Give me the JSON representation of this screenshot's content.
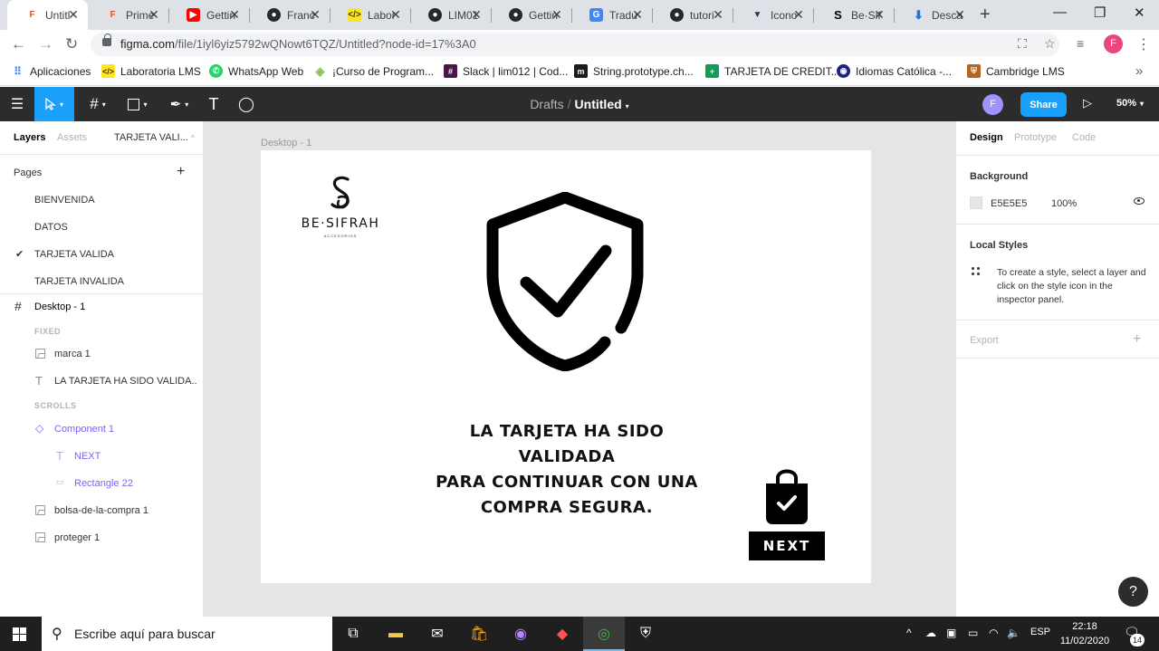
{
  "browser": {
    "tabs": [
      {
        "title": "Untitl",
        "icon": "figma-icon",
        "color": "#f24e1e"
      },
      {
        "title": "Prime",
        "icon": "figma-icon",
        "color": "#f24e1e"
      },
      {
        "title": "Gettin",
        "icon": "youtube-icon",
        "color": "#ff0000"
      },
      {
        "title": "Franc",
        "icon": "github-icon",
        "color": "#24292e"
      },
      {
        "title": "Labor",
        "icon": "laboratoria-icon",
        "color": "#ffe521"
      },
      {
        "title": "LIM01",
        "icon": "github-icon",
        "color": "#24292e"
      },
      {
        "title": "Gettin",
        "icon": "github-icon",
        "color": "#24292e"
      },
      {
        "title": "Tradu",
        "icon": "translate-icon",
        "color": "#4285f4"
      },
      {
        "title": "tutori",
        "icon": "github-icon",
        "color": "#24292e"
      },
      {
        "title": "Icono",
        "icon": "flaticon-icon",
        "color": "#1d3557"
      },
      {
        "title": "Be·Sif",
        "icon": "besifrah-icon",
        "color": "#000000"
      },
      {
        "title": "Desca",
        "icon": "download-icon",
        "color": "#1a73e8"
      }
    ],
    "url_host": "figma.com",
    "url_path": "/file/1iyl6yiz5792wQNowt6TQZ/Untitled?node-id=17%3A0",
    "profile_initial": "F",
    "bookmarks": [
      {
        "label": "Aplicaciones",
        "icon": "apps-grid-icon",
        "color": "#4285f4"
      },
      {
        "label": "Laboratoria LMS",
        "icon": "laboratoria-icon",
        "color": "#ffe521"
      },
      {
        "label": "WhatsApp Web",
        "icon": "whatsapp-icon",
        "color": "#25d366"
      },
      {
        "label": "¡Curso de Program...",
        "icon": "diamond-icon",
        "color": "#8bc34a"
      },
      {
        "label": "Slack | lim012 | Cod...",
        "icon": "slack-icon",
        "color": "#4a154b"
      },
      {
        "label": "String.prototype.ch...",
        "icon": "mdn-icon",
        "color": "#1b1b1b"
      },
      {
        "label": "TARJETA DE CREDIT...",
        "icon": "sheets-icon",
        "color": "#0f9d58"
      },
      {
        "label": "Idiomas Católica -...",
        "icon": "catolica-icon",
        "color": "#1a237e"
      },
      {
        "label": "Cambridge LMS",
        "icon": "cambridge-icon",
        "color": "#b5651d"
      }
    ]
  },
  "figma": {
    "breadcrumb_drafts": "Drafts",
    "breadcrumb_file": "Untitled",
    "avatar_initial": "F",
    "share_label": "Share",
    "zoom_label": "50%",
    "left_tabs": {
      "layers": "Layers",
      "assets": "Assets",
      "page": "TARJETA VALI..."
    },
    "pages_title": "Pages",
    "pages": [
      "BIENVENIDA",
      "DATOS",
      "TARJETA VALIDA",
      "TARJETA INVALIDA"
    ],
    "current_page_index": 2,
    "layers": {
      "frame": "Desktop - 1",
      "fixed_label": "FIXED",
      "fixed_items": [
        "marca 1",
        "LA TARJETA HA SIDO VALIDA..."
      ],
      "scrolls_label": "SCROLLS",
      "component": "Component 1",
      "component_children": [
        "NEXT",
        "Rectangle 22"
      ],
      "scroll_items": [
        "bolsa-de-la-compra 1",
        "proteger 1"
      ]
    },
    "canvas": {
      "frame_label": "Desktop - 1",
      "logo_name": "BE·SIFRAH",
      "logo_sub": "ACCESORIOS",
      "message_lines": [
        "LA TARJETA HA SIDO VALIDADA",
        "PARA CONTINUAR CON UNA",
        "COMPRA SEGURA."
      ],
      "next_label": "NEXT"
    },
    "right_tabs": {
      "design": "Design",
      "prototype": "Prototype",
      "code": "Code"
    },
    "background_title": "Background",
    "background_hex": "E5E5E5",
    "background_opacity": "100%",
    "local_styles_title": "Local Styles",
    "local_styles_hint": "To create a style, select a layer and click on the style icon in the inspector panel.",
    "export_title": "Export",
    "help_label": "?"
  },
  "taskbar": {
    "search_placeholder": "Escribe aquí para buscar",
    "lang": "ESP",
    "time": "22:18",
    "date": "11/02/2020",
    "notifications": "14"
  }
}
